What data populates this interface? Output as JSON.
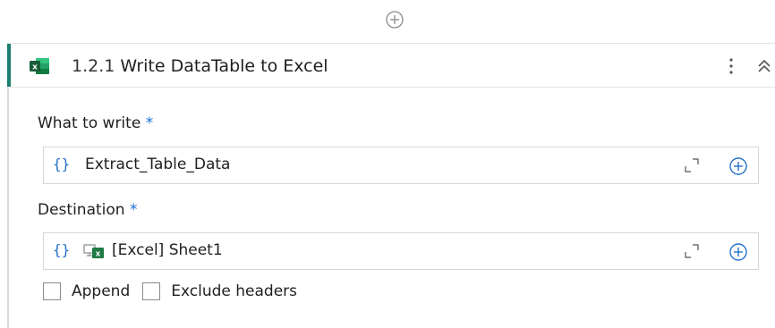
{
  "toolbar": {
    "add_icon": "plus-circle-icon"
  },
  "activity": {
    "number": "1.2.1",
    "title": "Write DataTable to Excel",
    "icon": "excel-icon",
    "accent_color": "#1a7f6e"
  },
  "fields": {
    "what_to_write": {
      "label": "What to write",
      "required": "*",
      "value": "Extract_Table_Data"
    },
    "destination": {
      "label": "Destination",
      "required": "*",
      "value": "[Excel] Sheet1"
    }
  },
  "options": {
    "append_label": "Append",
    "exclude_headers_label": "Exclude headers"
  },
  "colors": {
    "brace_blue": "#2472c8",
    "excel_green": "#1f7a43"
  }
}
